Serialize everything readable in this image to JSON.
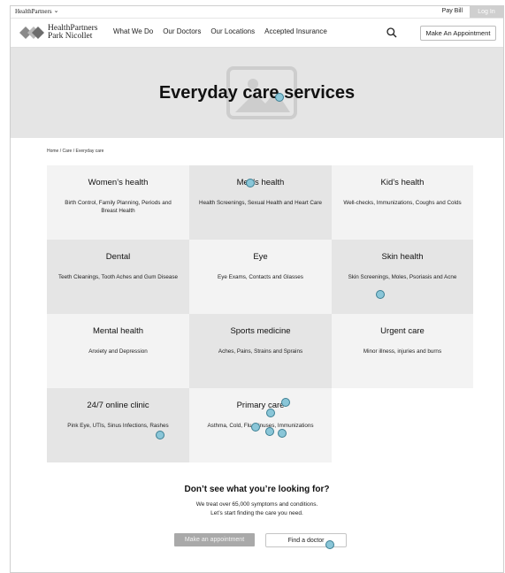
{
  "utility": {
    "brand": "HealthPartners",
    "pay_bill": "Pay Bill",
    "log_in": "Log In"
  },
  "nav": {
    "logo_line1": "HealthPartners",
    "logo_line2": "Park Nicollet",
    "links": [
      "What We Do",
      "Our Doctors",
      "Our Locations",
      "Accepted Insurance"
    ],
    "appointment_button": "Make An Appointment"
  },
  "hero": {
    "title": "Everyday care services"
  },
  "breadcrumb": "Home / Care / Everyday care",
  "services": [
    {
      "title": "Women’s health",
      "desc": "Birth Control, Family Planning, Periods and Breast Health"
    },
    {
      "title": "Men’s health",
      "desc": "Health Screenings, Sexual Health and Heart Care"
    },
    {
      "title": "Kid’s health",
      "desc": "Well-checks, Immunizations, Coughs and Colds"
    },
    {
      "title": "Dental",
      "desc": "Teeth Cleanings, Tooth Aches and Gum Disease"
    },
    {
      "title": "Eye",
      "desc": "Eye Exams, Contacts and Glasses"
    },
    {
      "title": "Skin health",
      "desc": "Skin Screenings, Moles, Psoriasis and Acne"
    },
    {
      "title": "Mental health",
      "desc": "Anxiety and Depression"
    },
    {
      "title": "Sports medicine",
      "desc": "Aches, Pains, Strains and Sprains"
    },
    {
      "title": "Urgent care",
      "desc": "Minor illness, injuries and burns"
    },
    {
      "title": "24/7 online clinic",
      "desc": "Pink Eye, UTIs, Sinus Infections, Rashes"
    },
    {
      "title": "Primary care",
      "desc": "Asthma, Cold, Flu, Sinuses, Immunizations"
    }
  ],
  "cta": {
    "title": "Don’t see what you’re looking for?",
    "line1": "We treat over 65,000 symptoms and conditions.",
    "line2": "Let’s start finding the care you need.",
    "make_appointment": "Make an appointment",
    "find_doctor": "Find a doctor"
  }
}
